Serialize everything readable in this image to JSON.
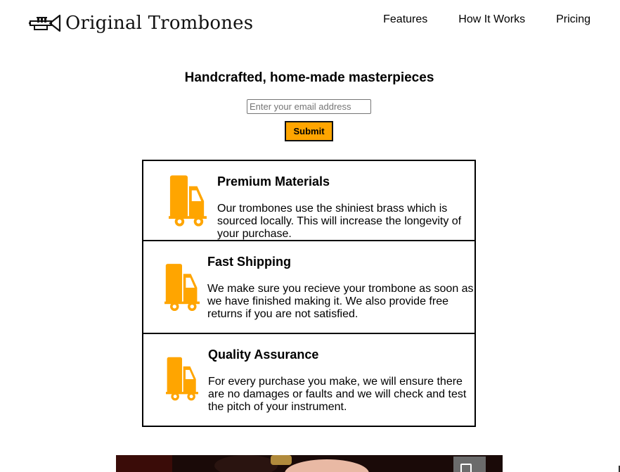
{
  "header": {
    "brand": "Original Trombones",
    "nav": [
      {
        "label": "Features"
      },
      {
        "label": "How It Works"
      },
      {
        "label": "Pricing"
      }
    ]
  },
  "hero": {
    "title": "Handcrafted, home-made masterpieces",
    "email_placeholder": "Enter your email address",
    "submit_label": "Submit"
  },
  "features": [
    {
      "title": "Premium Materials",
      "description": "Our trombones use the shiniest brass which is sourced locally. This will increase the longevity of your purchase.",
      "icon": "truck-icon"
    },
    {
      "title": "Fast Shipping",
      "description": "We make sure you recieve your trombone as soon as we have finished making it. We also provide free returns if you are not satisfied.",
      "icon": "truck-icon"
    },
    {
      "title": "Quality Assurance",
      "description": "For every purchase you make, we will ensure there are no damages or faults and we will check and test the pitch of your instrument.",
      "icon": "truck-icon"
    }
  ],
  "colors": {
    "accent": "#ffa500",
    "border": "#000000"
  }
}
